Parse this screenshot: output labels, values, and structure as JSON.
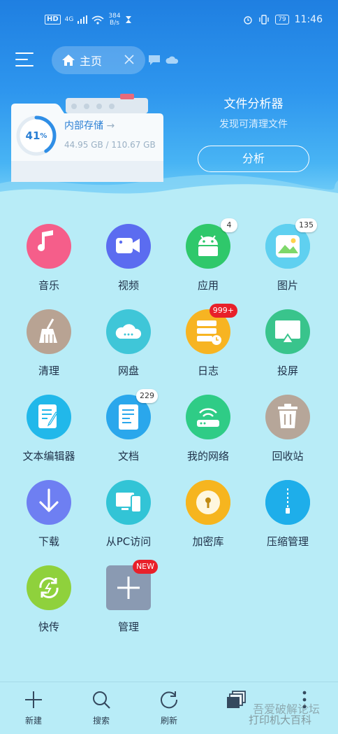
{
  "status_bar": {
    "hd": "HD",
    "network": "4G",
    "speed_value": "384",
    "speed_unit": "B/s",
    "battery": "79",
    "time": "11:46"
  },
  "toolbar": {
    "menu_icon": "hamburger-menu-icon",
    "tab_label": "主页",
    "tab_icon": "home-icon"
  },
  "storage": {
    "percent": "41",
    "percent_sign": "%",
    "label": "内部存储",
    "arrow": "→",
    "usage": "44.95 GB / 110.67 GB",
    "used_fraction": 0.41
  },
  "analyzer": {
    "title": "文件分析器",
    "subtitle": "发现可清理文件",
    "button": "分析"
  },
  "grid": [
    {
      "label": "音乐",
      "icon": "music-note-icon",
      "color": "#f55e8a",
      "badge": ""
    },
    {
      "label": "视频",
      "icon": "video-camera-icon",
      "color": "#5b6cf0",
      "badge": ""
    },
    {
      "label": "应用",
      "icon": "android-icon",
      "color": "#2fc86b",
      "badge": "4"
    },
    {
      "label": "图片",
      "icon": "image-icon",
      "color": "#5fd0f0",
      "badge": "135"
    },
    {
      "label": "清理",
      "icon": "broom-icon",
      "color": "#b8a393",
      "badge": ""
    },
    {
      "label": "网盘",
      "icon": "cloud-icon",
      "color": "#3fc6d8",
      "badge": ""
    },
    {
      "label": "日志",
      "icon": "log-stack-icon",
      "color": "#f7b422",
      "badge": "999+"
    },
    {
      "label": "投屏",
      "icon": "cast-screen-icon",
      "color": "#39c48c",
      "badge": ""
    },
    {
      "label": "文本编辑器",
      "icon": "text-edit-icon",
      "color": "#21b8ea",
      "badge": ""
    },
    {
      "label": "文档",
      "icon": "document-icon",
      "color": "#2aa7ec",
      "badge": "229"
    },
    {
      "label": "我的网络",
      "icon": "router-icon",
      "color": "#2fcc86",
      "badge": ""
    },
    {
      "label": "回收站",
      "icon": "trash-icon",
      "color": "#b6a699",
      "badge": ""
    },
    {
      "label": "下载",
      "icon": "download-icon",
      "color": "#6e7ff2",
      "badge": ""
    },
    {
      "label": "从PC访问",
      "icon": "pc-phone-icon",
      "color": "#32c4d6",
      "badge": ""
    },
    {
      "label": "加密库",
      "icon": "lock-icon",
      "color": "#f6b51f",
      "badge": ""
    },
    {
      "label": "压缩管理",
      "icon": "zip-icon",
      "color": "#1eaeea",
      "badge": ""
    },
    {
      "label": "快传",
      "icon": "sync-transfer-icon",
      "color": "#8fd13c",
      "badge": ""
    },
    {
      "label": "管理",
      "icon": "add-icon",
      "color": "#8a9ab2",
      "badge": "NEW"
    }
  ],
  "bottom_bar": [
    {
      "label": "新建",
      "icon": "plus-icon"
    },
    {
      "label": "搜索",
      "icon": "search-icon"
    },
    {
      "label": "刷新",
      "icon": "refresh-icon"
    },
    {
      "label": "",
      "icon": "windows-icon"
    },
    {
      "label": "",
      "icon": "more-vertical-icon"
    }
  ],
  "watermark": {
    "line1": "吾爱破解论坛",
    "line2": "打印机大百科"
  }
}
